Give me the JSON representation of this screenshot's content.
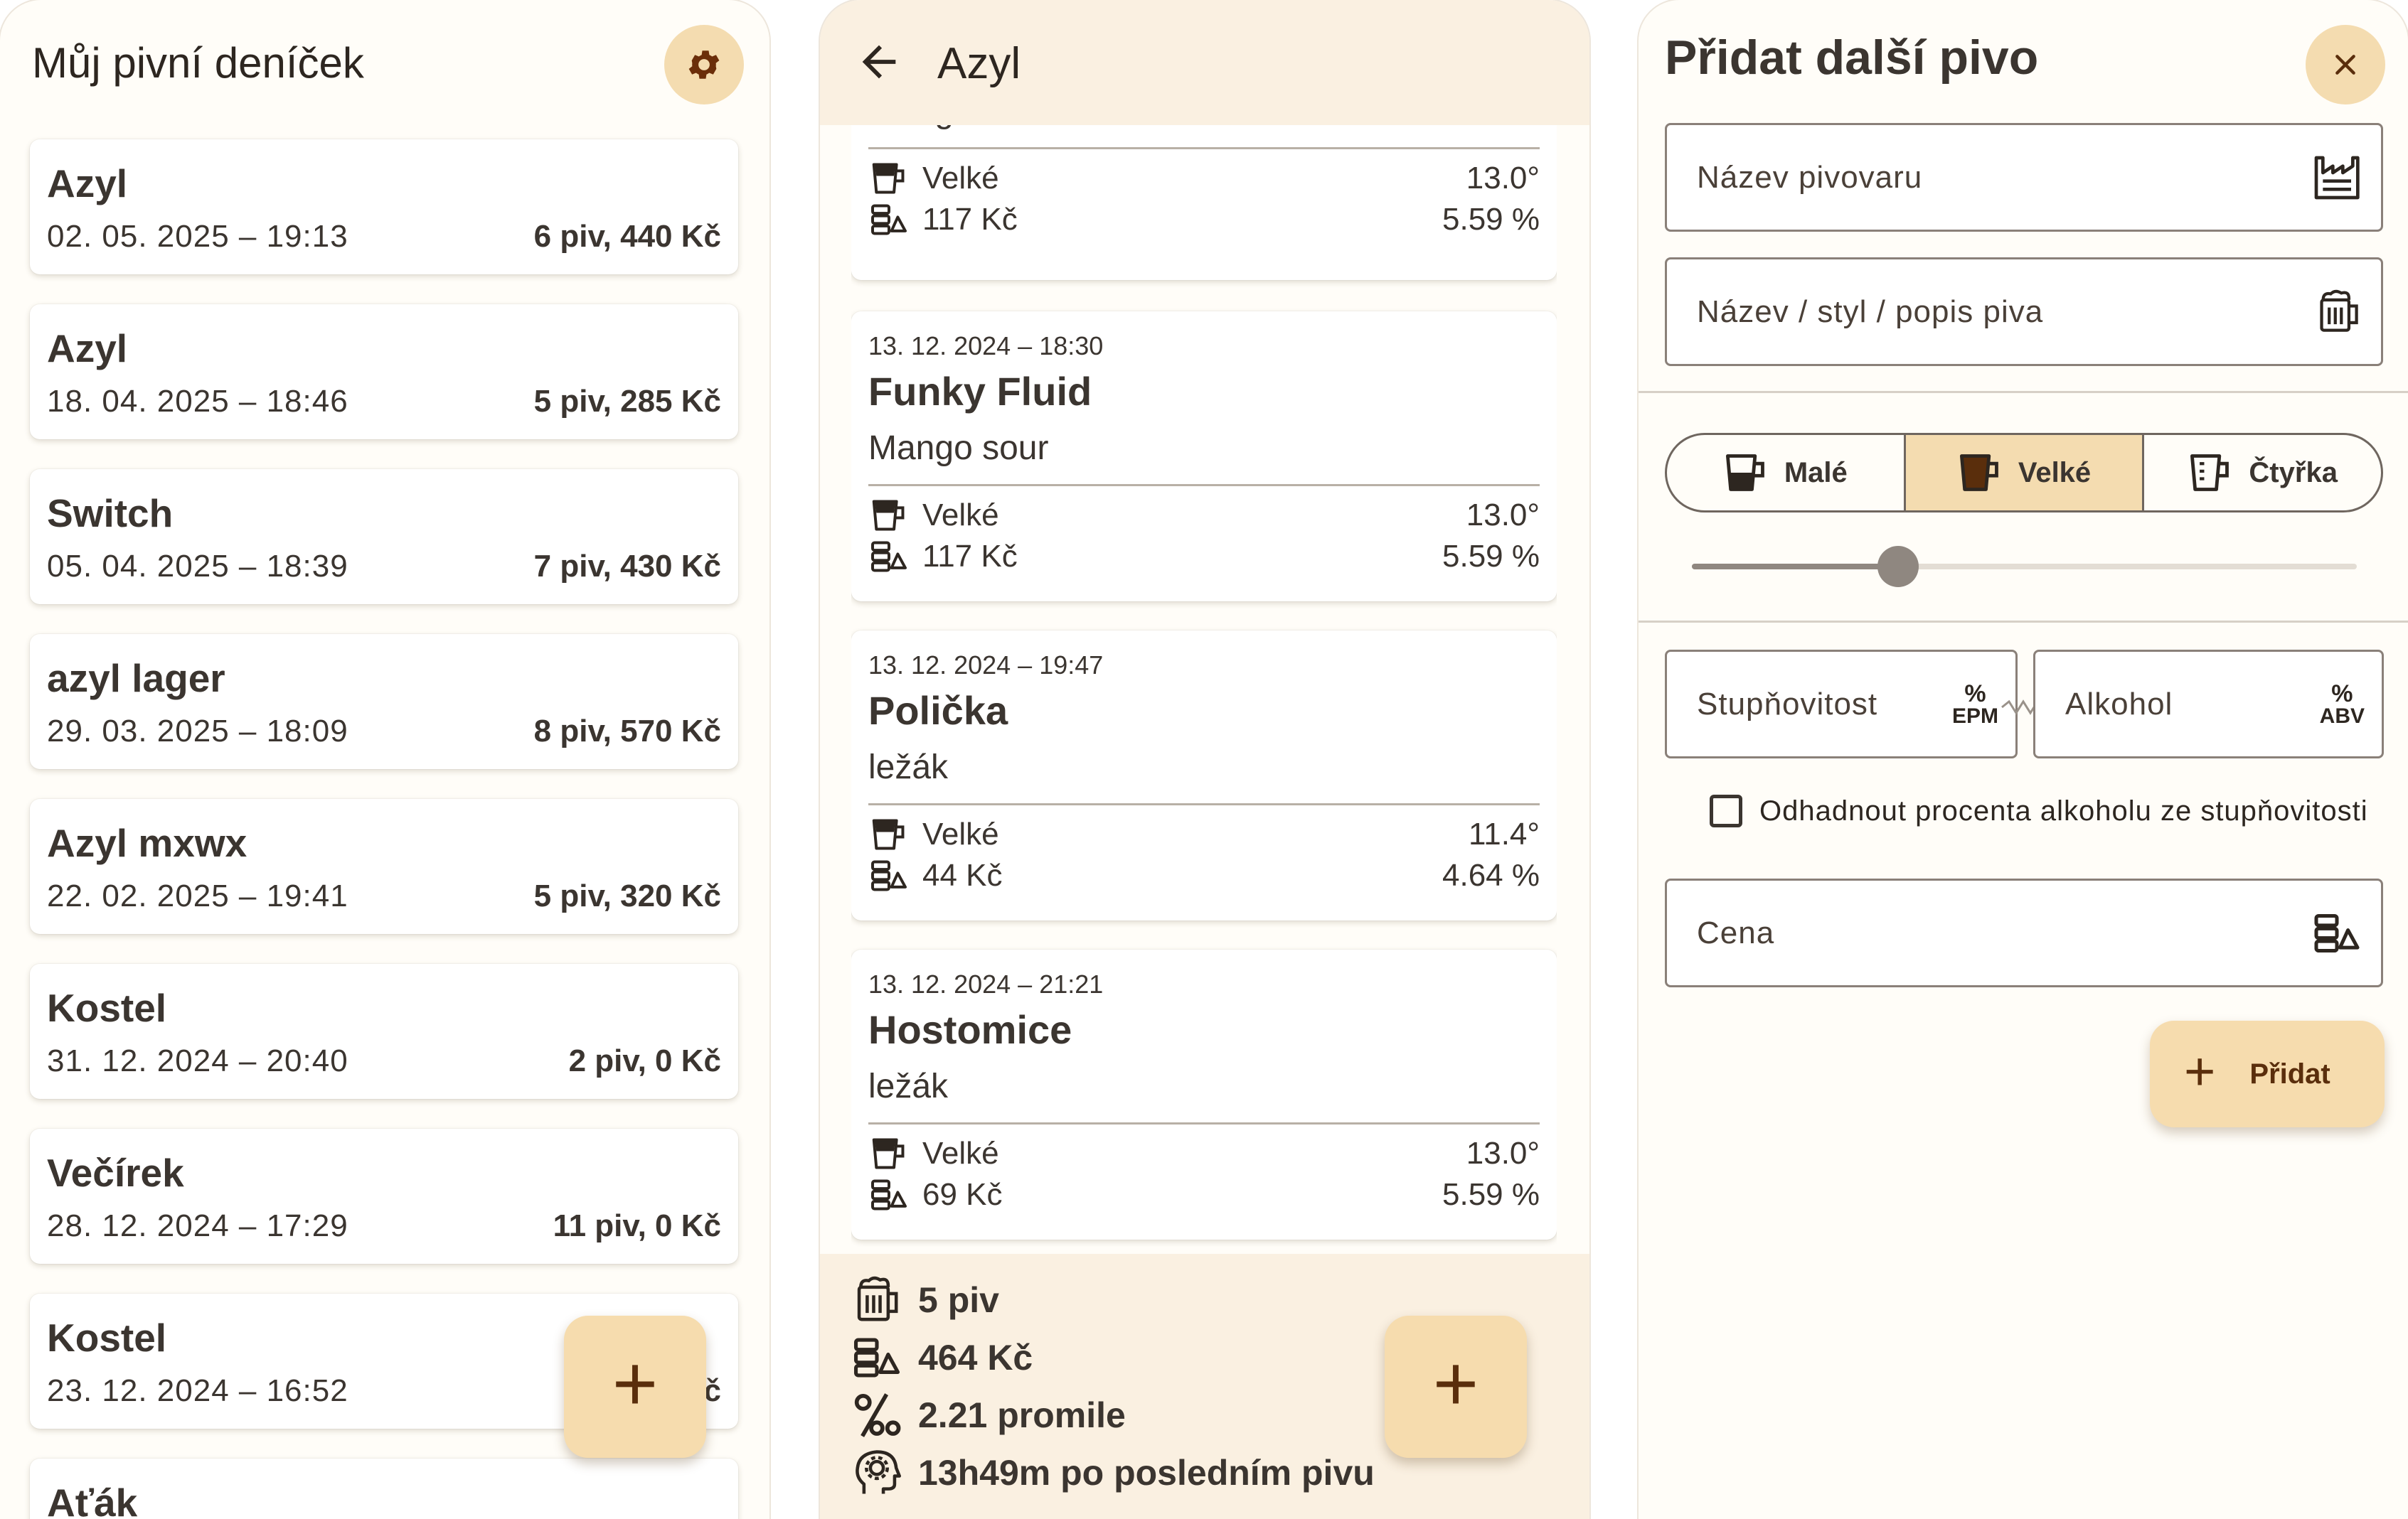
{
  "journal": {
    "title": "Můj pivní deníček",
    "settings_icon": "gear-icon",
    "accent": "#f4dcb0",
    "entries": [
      {
        "name": "Azyl",
        "date": "02. 05. 2025 – 19:13",
        "summary": "6 piv, 440 Kč"
      },
      {
        "name": "Azyl",
        "date": "18. 04. 2025 – 18:46",
        "summary": "5 piv, 285 Kč"
      },
      {
        "name": "Switch",
        "date": "05. 04. 2025 – 18:39",
        "summary": "7 piv, 430 Kč"
      },
      {
        "name": "azyl lager",
        "date": "29. 03. 2025 – 18:09",
        "summary": "8 piv, 570 Kč"
      },
      {
        "name": "Azyl mxwx",
        "date": "22. 02. 2025 – 19:41",
        "summary": "5 piv, 320 Kč"
      },
      {
        "name": "Kostel",
        "date": "31. 12. 2024 – 20:40",
        "summary": "2 piv, 0 Kč"
      },
      {
        "name": "Večírek",
        "date": "28. 12. 2024 – 17:29",
        "summary": "11 piv, 0 Kč"
      },
      {
        "name": "Kostel",
        "date": "23. 12. 2024 – 16:52",
        "summary": "č"
      },
      {
        "name": "Aťák",
        "date": "",
        "summary": ""
      }
    ],
    "fab_label": "+"
  },
  "session": {
    "title": "Azyl",
    "back_icon": "arrow-left-icon",
    "entries": [
      {
        "time": "",
        "brewery": "",
        "style": "Mango sour",
        "size": "Velké",
        "price": "117 Kč",
        "degree": "13.0°",
        "abv": "5.59 %"
      },
      {
        "time": "13. 12. 2024 – 18:30",
        "brewery": "Funky Fluid",
        "style": "Mango sour",
        "size": "Velké",
        "price": "117 Kč",
        "degree": "13.0°",
        "abv": "5.59 %"
      },
      {
        "time": "13. 12. 2024 – 19:47",
        "brewery": "Polička",
        "style": "ležák",
        "size": "Velké",
        "price": "44 Kč",
        "degree": "11.4°",
        "abv": "4.64 %"
      },
      {
        "time": "13. 12. 2024 – 21:21",
        "brewery": "Hostomice",
        "style": "ležák",
        "size": "Velké",
        "price": "69 Kč",
        "degree": "13.0°",
        "abv": "5.59 %"
      }
    ],
    "summary": {
      "count": "5 piv",
      "total": "464 Kč",
      "promile": "2.21 promile",
      "since_last": "13h49m po posledním pivu"
    },
    "fab_label": "+"
  },
  "add_form": {
    "title": "Přidat další pivo",
    "close_icon": "close-icon",
    "brewery_placeholder": "Název pivovaru",
    "beer_placeholder": "Název / styl / popis piva",
    "sizes": [
      "Malé",
      "Velké",
      "Čtyřka"
    ],
    "selected_size": "Velké",
    "slider_fraction": 0.31,
    "degree_placeholder": "Stupňovitost",
    "degree_unit_top": "%",
    "degree_unit_bottom": "EPM",
    "alcohol_placeholder": "Alkohol",
    "alcohol_unit_top": "%",
    "alcohol_unit_bottom": "ABV",
    "estimate_label": "Odhadnout procenta alkoholu ze stupňovitosti",
    "estimate_checked": false,
    "price_placeholder": "Cena",
    "add_plus": "+",
    "add_label": "Přidat"
  }
}
